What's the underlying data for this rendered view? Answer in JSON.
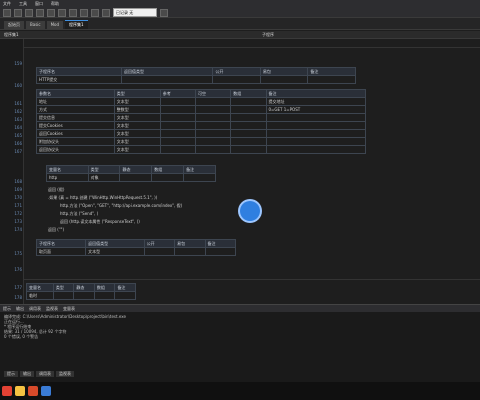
{
  "menu": [
    "文件",
    "工具",
    "窗口",
    "帮助"
  ],
  "toolbar": {
    "combo_value": "已记录 无"
  },
  "tabs": [
    "起始页",
    "Basic",
    "Mod",
    "程序集1"
  ],
  "subheader": {
    "left": "程序集1",
    "right": "子程序"
  },
  "lines": [
    "159",
    "160",
    "161",
    "162",
    "163",
    "164",
    "165",
    "166",
    "167",
    "168",
    "169",
    "170",
    "171",
    "172",
    "173",
    "174",
    "175",
    "176",
    "177",
    "178"
  ],
  "tables": {
    "sub1": {
      "header": [
        "子程序名",
        "返回值类型",
        "公开",
        "易包",
        "备注"
      ],
      "row": [
        "HTTP提交",
        "",
        "",
        "",
        ""
      ],
      "params_header": [
        "参数名",
        "类型",
        "参考",
        "可空",
        "数组",
        "备注"
      ],
      "params": [
        [
          "地址",
          "文本型",
          "",
          "",
          "",
          "提交地址"
        ],
        [
          "方式",
          "整数型",
          "",
          "",
          "",
          "0=GET 1=POST"
        ],
        [
          "提交信息",
          "文本型",
          "",
          "",
          "",
          ""
        ],
        [
          "提交Cookies",
          "文本型",
          "",
          "",
          "",
          ""
        ],
        [
          "返回Cookies",
          "文本型",
          "",
          "",
          "",
          ""
        ],
        [
          "附加协议头",
          "文本型",
          "",
          "",
          "",
          ""
        ],
        [
          "返回协议头",
          "文本型",
          "",
          "",
          "",
          ""
        ]
      ]
    },
    "vars": {
      "header": [
        "变量名",
        "类型",
        "静态",
        "数组",
        "备注"
      ],
      "rows": [
        [
          "http",
          "对象"
        ]
      ]
    },
    "sub2": {
      "header": [
        "子程序名",
        "返回值类型",
        "公开",
        "易包",
        "备注"
      ],
      "row": [
        "取页面",
        "文本型",
        "",
        "",
        ""
      ]
    },
    "sub3": {
      "header": [
        "变量名",
        "类型",
        "静态",
        "数组",
        "备注"
      ],
      "row": [
        "临时",
        "",
        "",
        "",
        ""
      ]
    }
  },
  "code": {
    "c1": "返回 (假)",
    "c2": ".如果 (真 = http.创建 (\"WinHttp.WinHttpRequest.5.1\", ))",
    "c3": "http.方法 (\"Open\", \"GET\", \"http://api.example.com/index\", 假)",
    "c4": "http.方法 (\"Send\", )",
    "c5": "返回 (http.读文本属性 (\"ResponseText\", ))",
    "c6": "返回 (\"\")"
  },
  "output": {
    "title_tabs": [
      "提示",
      "输出",
      "调用表",
      "监视表",
      "变量表"
    ],
    "lines": [
      "编译完成: C:\\Users\\Administrator\\Desktop\\project\\bin\\test.exe",
      "正在运行...",
      "* 程序运行结束",
      "结果: 31 / 10094, 总计 92 个字符",
      "0 个错误, 0 个警告",
      ""
    ]
  },
  "bottom_tabs": [
    "提示",
    "输出",
    "调用表",
    "监视表"
  ],
  "colors": {
    "accent": "#2f7fe0",
    "green": "#4ec94e",
    "orange": "#e88b2e"
  }
}
